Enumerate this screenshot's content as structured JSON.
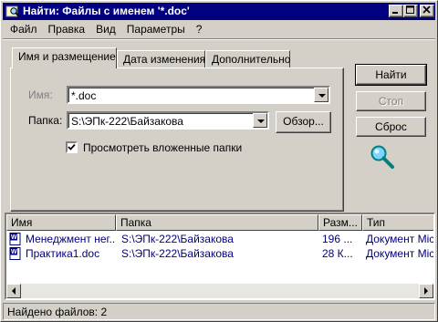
{
  "window": {
    "title": "Найти: Файлы с именем '*.doc'",
    "controls": [
      "minimize",
      "maximize",
      "close"
    ]
  },
  "menu": {
    "items": [
      {
        "label": "Файл"
      },
      {
        "label": "Правка"
      },
      {
        "label": "Вид"
      },
      {
        "label": "Параметры"
      },
      {
        "label": "?"
      }
    ]
  },
  "tabs": [
    {
      "label": "Имя и размещение",
      "active": true
    },
    {
      "label": "Дата изменения",
      "active": false
    },
    {
      "label": "Дополнительно",
      "active": false
    }
  ],
  "form": {
    "name_label": "Имя:",
    "name_value": "*.doc",
    "folder_label": "Папка:",
    "folder_value": "S:\\ЭПк-222\\Байзакова",
    "browse_label": "Обзор...",
    "subfolders_label": "Просмотреть вложенные папки",
    "subfolders_checked": true
  },
  "actions": {
    "find_label": "Найти",
    "stop_label": "Стоп",
    "reset_label": "Сброс"
  },
  "results": {
    "columns": [
      "Имя",
      "Папка",
      "Разм...",
      "Тип"
    ],
    "rows": [
      {
        "name": "Менеджмент нег...",
        "folder": "S:\\ЭПк-222\\Байзакова",
        "size": "196 ...",
        "type": "Документ Micr"
      },
      {
        "name": "Практика1.doc",
        "folder": "S:\\ЭПк-222\\Байзакова",
        "size": "28 К...",
        "type": "Документ Micr"
      }
    ]
  },
  "status": {
    "text": "Найдено файлов: 2"
  },
  "colors": {
    "titlebar": "#000080",
    "face": "#d4d0c8",
    "link_text": "#00007b"
  }
}
